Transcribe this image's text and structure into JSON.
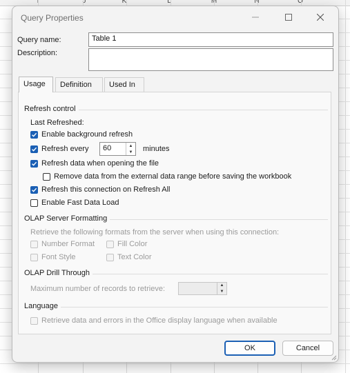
{
  "sheet": {
    "columns": [
      "I",
      "J",
      "K",
      "L",
      "M",
      "N",
      "O"
    ]
  },
  "dialog": {
    "title": "Query Properties",
    "query_name_label": "Query name:",
    "query_name_value": "Table 1",
    "description_label": "Description:",
    "description_value": "",
    "tabs": [
      {
        "label": "Usage",
        "active": true
      },
      {
        "label": "Definition",
        "active": false
      },
      {
        "label": "Used In",
        "active": false
      }
    ],
    "refresh_control": {
      "heading": "Refresh control",
      "last_refreshed": "Last Refreshed:",
      "enable_background": {
        "label": "Enable background refresh",
        "checked": true
      },
      "refresh_every": {
        "label": "Refresh every",
        "checked": true,
        "value": "60",
        "unit": "minutes"
      },
      "refresh_on_open": {
        "label": "Refresh data when opening the file",
        "checked": true
      },
      "remove_data": {
        "label": "Remove data from the external data range before saving the workbook",
        "checked": false
      },
      "refresh_all": {
        "label": "Refresh this connection on Refresh All",
        "checked": true
      },
      "fast_load": {
        "label": "Enable Fast Data Load",
        "checked": false
      }
    },
    "olap_formatting": {
      "heading": "OLAP Server Formatting",
      "desc": "Retrieve the following formats from the server when using this connection:",
      "number_format": "Number Format",
      "fill_color": "Fill Color",
      "font_style": "Font Style",
      "text_color": "Text Color"
    },
    "olap_drill": {
      "heading": "OLAP Drill Through",
      "max_records": "Maximum number of records to retrieve:",
      "max_value": ""
    },
    "language": {
      "heading": "Language",
      "retrieve_label": "Retrieve data and errors in the Office display language when available"
    },
    "ok_label": "OK",
    "cancel_label": "Cancel"
  }
}
